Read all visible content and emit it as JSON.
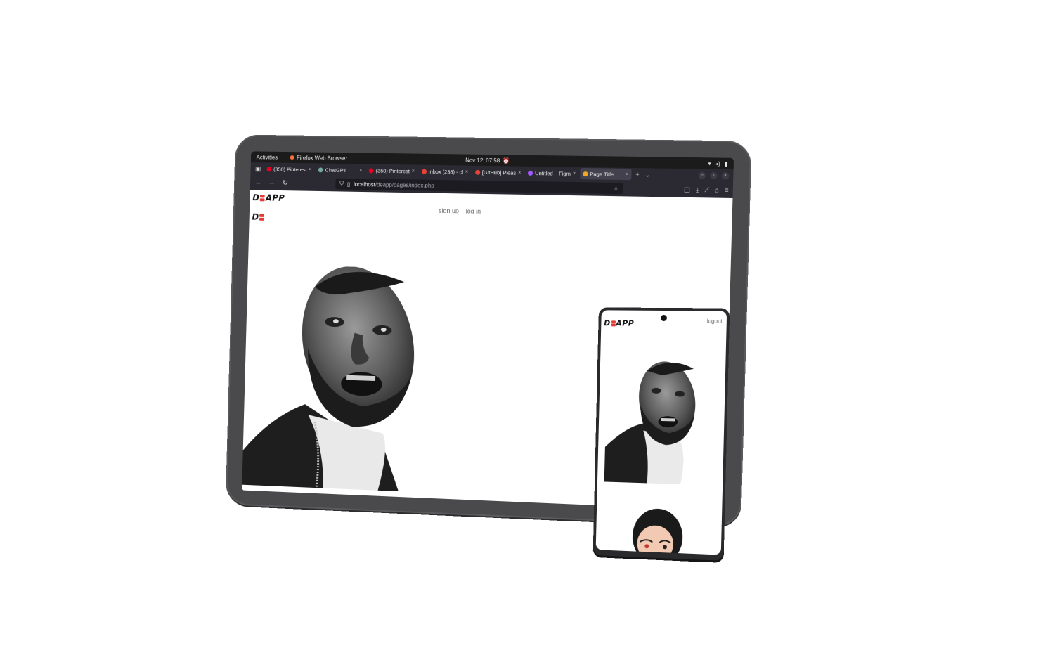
{
  "os_bar": {
    "activities": "Activities",
    "app_name": "Firefox Web Browser",
    "date": "Nov 12",
    "time": "07:58"
  },
  "tabs": [
    {
      "label": "(350) Pinterest",
      "favicon_color": "#e60023",
      "active": false
    },
    {
      "label": "ChatGPT",
      "favicon_color": "#74aa9c",
      "active": false
    },
    {
      "label": "(350) Pinterest",
      "favicon_color": "#e60023",
      "active": false
    },
    {
      "label": "Inbox (238) - cl",
      "favicon_color": "#ea4335",
      "active": false
    },
    {
      "label": "[GitHub] Pleas",
      "favicon_color": "#ea4335",
      "active": false
    },
    {
      "label": "Untitled – Figm",
      "favicon_color": "#a259ff",
      "active": false
    },
    {
      "label": "Page Title",
      "favicon_color": "#f5a623",
      "active": true
    }
  ],
  "url": {
    "host": "localhost",
    "path": "/deapp/pages/index.php"
  },
  "brand": {
    "prefix": "D",
    "suffix": "APP"
  },
  "nav_links": {
    "signup": "sign up",
    "login": "log in"
  },
  "phone": {
    "logout": "logout"
  },
  "colors": {
    "brand_accent": "#e53935",
    "device_frame": "#4a4a4c",
    "browser_chrome": "#2b2a33"
  }
}
